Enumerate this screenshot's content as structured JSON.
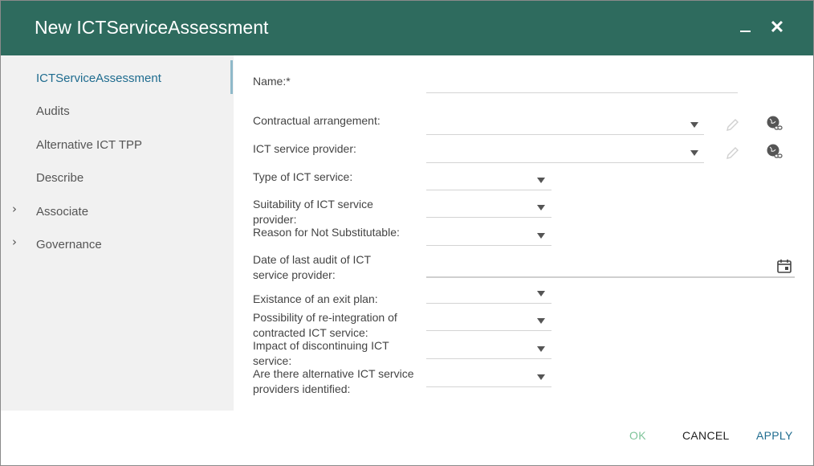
{
  "window": {
    "title": "New ICTServiceAssessment",
    "minimize_icon": "minimize-icon",
    "close_icon": "close-icon",
    "close_glyph": "✕"
  },
  "sidebar": {
    "items": [
      {
        "label": "ICTServiceAssessment",
        "active": true
      },
      {
        "label": "Audits"
      },
      {
        "label": "Alternative ICT TPP"
      },
      {
        "label": "Describe"
      },
      {
        "label": "Associate",
        "expandable": true
      },
      {
        "label": "Governance",
        "expandable": true
      }
    ],
    "chevron_glyph": "›"
  },
  "form": {
    "name_label": "Name:*",
    "name_value": "",
    "contractual_label": "Contractual arrangement:",
    "provider_label": "ICT service provider:",
    "type_label": "Type of ICT service:",
    "suitability_label_1": "Suitability of ICT service",
    "suitability_label_2": "provider:",
    "reason_label": "Reason for Not Substitutable:",
    "audit_date_label_1": "Date of last audit of ICT",
    "audit_date_label_2": "service provider:",
    "exit_plan_label": "Existance of an exit plan:",
    "reintegration_label_1": "Possibility of re-integration of",
    "reintegration_label_2": "contracted ICT service:",
    "impact_label_1": "Impact of discontinuing ICT",
    "impact_label_2": "service:",
    "alternatives_label_1": "Are there alternative ICT service",
    "alternatives_label_2": "providers identified:"
  },
  "footer": {
    "ok": "OK",
    "cancel": "CANCEL",
    "apply": "APPLY"
  },
  "colors": {
    "titlebar": "#2e6b5e",
    "accent": "#1f6c8f",
    "ok_disabled": "#7fc49a",
    "sidebar_bg": "#f1f1f1"
  }
}
